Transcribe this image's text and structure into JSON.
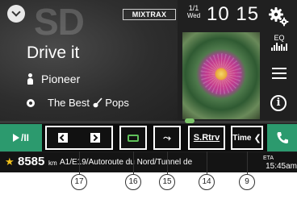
{
  "header": {
    "source_watermark": "SD",
    "mixtrax_label": "MIXTRAX",
    "date_line1": "1/1",
    "date_line2": "Wed",
    "clock": "10 15"
  },
  "side_buttons": {
    "eq_label": "EQ"
  },
  "track": {
    "title": "Drive it",
    "artist": "Pioneer",
    "album": "The Best",
    "genre_icon": "guitar",
    "genre": "Pops"
  },
  "controls": {
    "play_pause_label": "/II",
    "srtrv_label": "S.Rtrv",
    "time_label": "Time",
    "shuffle_glyph": "⤳"
  },
  "navigation": {
    "distance": "8585",
    "unit": "km",
    "road": "A1/E19/Autoroute du Nord/Tunnel de",
    "time_prefix": "ETA",
    "time": "15:45am"
  },
  "callouts": [
    {
      "label": "17"
    },
    {
      "label": "16"
    },
    {
      "label": "15"
    },
    {
      "label": "14"
    },
    {
      "label": "9"
    }
  ],
  "colors": {
    "accent_green": "#2c9a6e",
    "repeat_green": "#5fc05a",
    "star_yellow": "#f3c21b"
  }
}
